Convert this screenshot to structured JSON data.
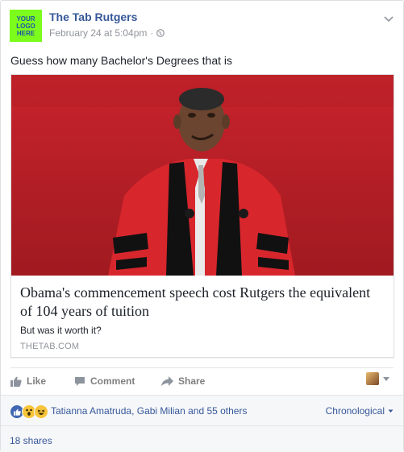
{
  "post": {
    "page_name": "The Tab Rutgers",
    "logo_text": "YOUR\nLOGO\nHERE",
    "timestamp": "February 24 at 5:04pm",
    "separator": "·",
    "status_text": "Guess how many Bachelor's Degrees that is"
  },
  "link_card": {
    "title": "Obama's commencement speech cost Rutgers the equivalent of 104 years of tuition",
    "description": "But was it worth it?",
    "domain": "THETAB.COM"
  },
  "actions": {
    "like_label": "Like",
    "comment_label": "Comment",
    "share_label": "Share"
  },
  "reactions": {
    "icons": [
      "like-icon",
      "wow-icon",
      "haha-icon"
    ],
    "summary": "Tatianna Amatruda, Gabi Milian and 55 others",
    "sort_label": "Chronological"
  },
  "shares": {
    "label": "18 shares"
  },
  "colors": {
    "link_blue": "#365899",
    "logo_green": "#7cfc1c",
    "meta_gray": "#90949c",
    "reaction_blue": "#4267b2",
    "reaction_yellow": "#f7c43a"
  }
}
